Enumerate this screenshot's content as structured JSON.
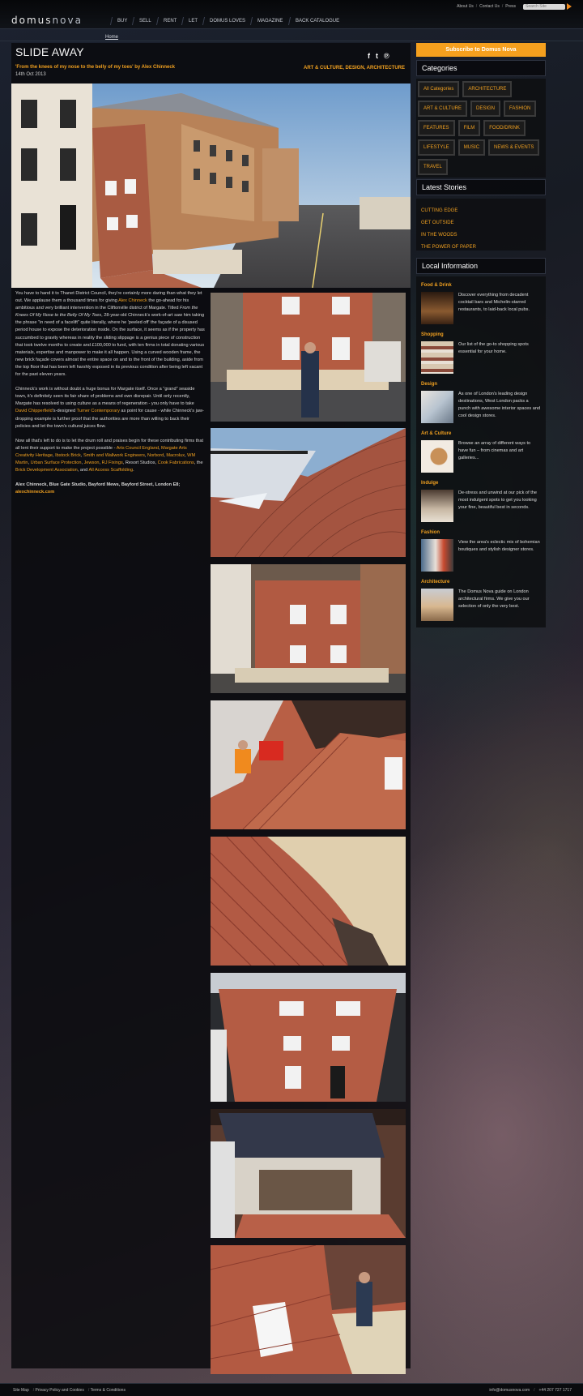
{
  "header": {
    "logo_a": "domus",
    "logo_b": "nova",
    "nav": [
      "BUY",
      "SELL",
      "RENT",
      "LET",
      "DOMUS LOVES",
      "MAGAZINE",
      "BACK CATALOGUE"
    ],
    "utility": [
      "About Us",
      "Contact Us",
      "Press"
    ],
    "search_placeholder": "Search Site"
  },
  "breadcrumb": "Home",
  "article": {
    "title": "SLIDE AWAY",
    "subtitle": "'From the knees of my nose to the belly of my toes' by Alex Chinneck",
    "date": "14th Oct 2013",
    "categories": "ART & CULTURE, DESIGN, ARCHITECTURE",
    "p1": {
      "a": "You have to hand it to Thanet District Council, they're certainly more daring than what they let out. We applause them a thousand times for giving ",
      "link1": "Alex Chinneck",
      "b": " the go-ahead for his ambitious and very brilliant intervention in the Cliftonville district of Margate. Titled ",
      "em": "From the Knees Of My Nose to the Belly Of My Toes",
      "c": ", 28-year-old Chinneck's work-of-art saw him taking the phrase \"in need of a facelift\" quite literally, where he 'peeled off' the façade of a disused period house to expose the deterioration inside. On the surface, it seems as if the property has succumbed to gravity whereas in reality the sliding slippage is a genius piece of construction that took twelve months to create and £100,000 to fund, with ten firms in total donating various materials, expertise and manpower to make it all happen. Using a curved wooden frame, the new brick façade covers almost the entire space on and to the front of the building, aside from the top floor that has been left harshly exposed in its previous condition after being left vacant for the past eleven years."
    },
    "p2": {
      "a": "Chinneck's work is without doubt a huge bonus for Margate itself. Once a \"grand\" seaside town, it's definitely seen its fair share of problems and own disrepair. Until only recently, Margate has resolved to using culture as a means of regeneration - you only have to take ",
      "link1": "David Chipperfield",
      "b": "'s-designed ",
      "link2": "Turner Contemporary",
      "c": " as point for cause - while Chinneck's jaw-dropping example is further proof that the authorities are more than willing to back their policies and let the town's cultural juices flow."
    },
    "p3": {
      "a": "Now all that's left to do is to let the drum roll and praises begin for these contributing firms that all lent their support to make the project possible - ",
      "links": [
        "Arts Council England",
        "Margate Arts Creativity Heritage",
        "Ibstock Brick",
        "Smith and Wallwork Engineers",
        "Norbord",
        "Macrolux",
        "WM Martin",
        "Urban Surface Protection",
        "Jewson",
        "RJ Fixings"
      ],
      "b": ", Resort Studios, ",
      "link_a": "Cook Fabrications",
      "c": ", the ",
      "link_b": "Brick Development Association",
      "d": ", and ",
      "link_c": "All Access Scaffolding",
      "e": "."
    },
    "credit": "Alex Chinneck, Blue Gate Studio, Bayford Mews, Bayford Street, London E8;",
    "credit_link": "alexchinneck.com"
  },
  "sidebar": {
    "subscribe": "Subscribe to Domus Nova",
    "categories_title": "Categories",
    "categories": [
      "All Categories",
      "ARCHITECTURE",
      "ART & CULTURE",
      "DESIGN",
      "FASHION",
      "FEATURES",
      "FILM",
      "FOOD/DRINK",
      "LIFESTYLE",
      "MUSIC",
      "NEWS & EVENTS",
      "TRAVEL"
    ],
    "latest_title": "Latest Stories",
    "latest": [
      "CUTTING EDGE",
      "GET OUTSIDE",
      "IN THE WOODS",
      "THE POWER OF PAPER"
    ],
    "local_title": "Local Information",
    "local": [
      {
        "cat": "Food & Drink",
        "desc": "Discover everything from decadent cocktail bars and Michelin-starred restaurants, to laid-back local pubs."
      },
      {
        "cat": "Shopping",
        "desc": "Our list of the go-to shopping spots essential for your home."
      },
      {
        "cat": "Design",
        "desc": "As one of London's leading design destinations, West London packs a punch with awesome interior spaces and cool design stores."
      },
      {
        "cat": "Art & Culture",
        "desc": "Browse an array of different ways to have fun – from cinemas and art galleries..."
      },
      {
        "cat": "Indulge",
        "desc": "De-stress and unwind at our pick of the most indulgent spots to get you looking your fine, beautiful best in seconds."
      },
      {
        "cat": "Fashion",
        "desc": "View the area's eclectic mix of bohemian boutiques and stylish designer stores."
      },
      {
        "cat": "Architecture",
        "desc": "The Domus Nova guide on London architectural firms. We give you our selection of only the very best."
      }
    ]
  },
  "footer": {
    "links": [
      "Site Map",
      "Privacy Policy and Cookies",
      "Terms & Conditions"
    ],
    "email": "info@domusnova.com",
    "phone": "+44 207 727 1717"
  },
  "colors": {
    "accent": "#f0a020",
    "subscribe_bg": "#f5a01e",
    "panel": "#0a0b0e"
  }
}
